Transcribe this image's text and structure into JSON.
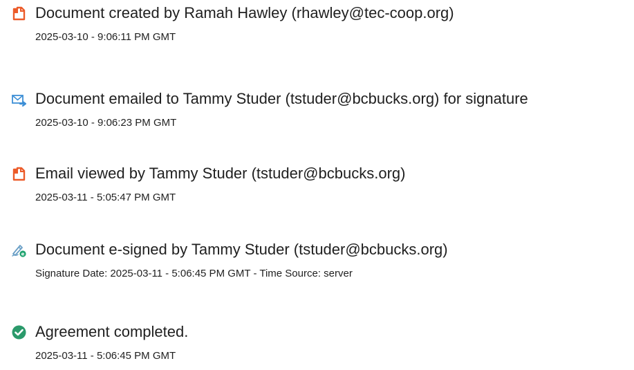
{
  "events": [
    {
      "icon": "document-icon",
      "title": "Document created by Ramah Hawley (rhawley@tec-coop.org)",
      "timestamp": "2025-03-10 - 9:06:11 PM GMT"
    },
    {
      "icon": "email-sent-icon",
      "title": "Document emailed to Tammy Studer (tstuder@bcbucks.org) for signature",
      "timestamp": "2025-03-10 - 9:06:23 PM GMT"
    },
    {
      "icon": "document-icon",
      "title": "Email viewed by Tammy Studer (tstuder@bcbucks.org)",
      "timestamp": "2025-03-11 - 5:05:47 PM GMT"
    },
    {
      "icon": "e-sign-icon",
      "title": "Document e-signed by Tammy Studer (tstuder@bcbucks.org)",
      "timestamp": "Signature Date: 2025-03-11 - 5:06:45 PM GMT - Time Source: server"
    },
    {
      "icon": "check-circle-icon",
      "title": "Agreement completed.",
      "timestamp": "2025-03-11 - 5:06:45 PM GMT"
    }
  ],
  "colors": {
    "document_icon": "#ec5b29",
    "email_icon": "#3d8fd6",
    "esign_icon": "#6a9fc6",
    "esign_badge": "#1fa36f",
    "check_icon": "#2b9a6b",
    "text": "#1f1f1f"
  }
}
